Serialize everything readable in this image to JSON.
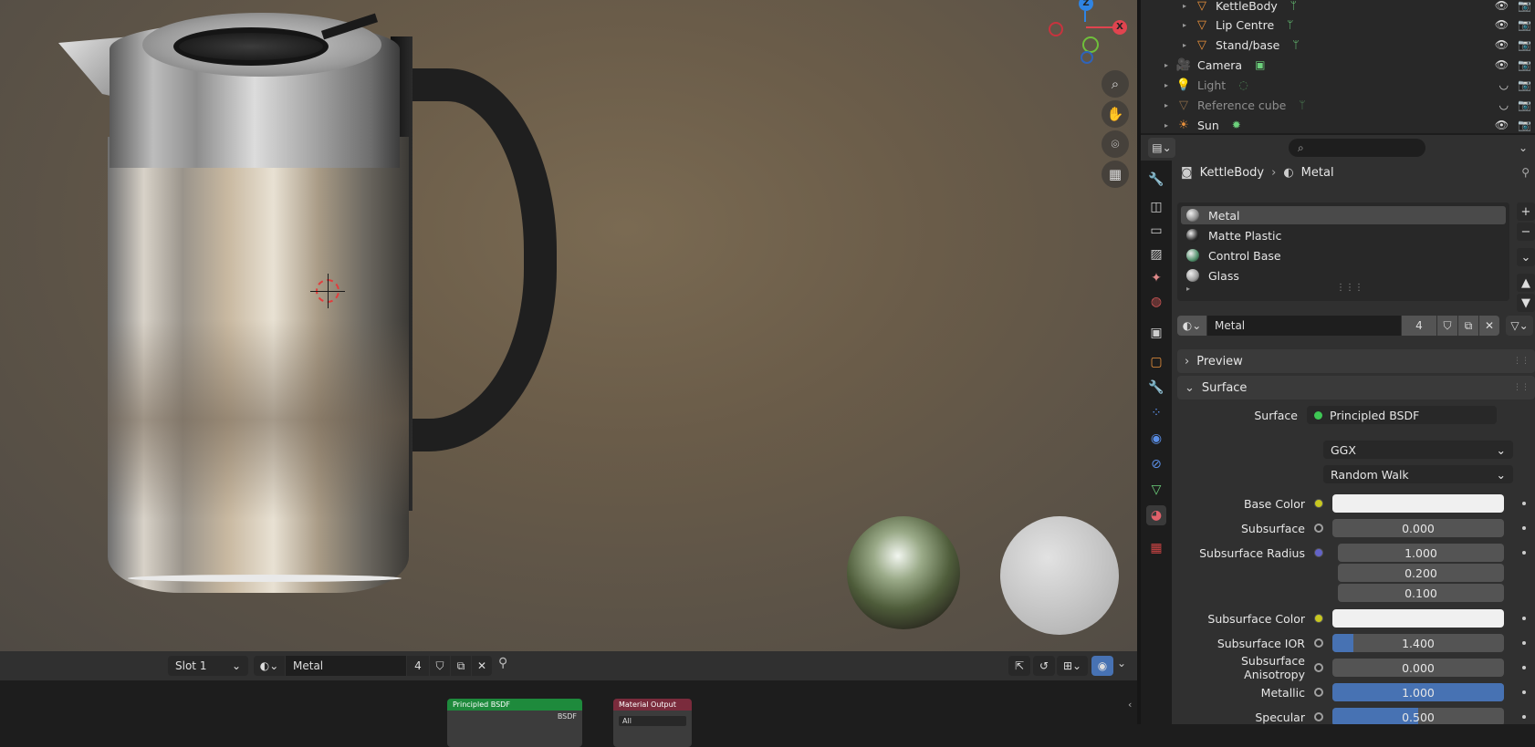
{
  "viewport": {
    "gizmo_labels": {
      "z": "Z",
      "x": "X"
    },
    "nav_icons": [
      "zoom-icon",
      "hand-icon",
      "camera-icon",
      "grid-icon"
    ]
  },
  "viewport_header": {
    "slot": "Slot 1",
    "material_name": "Metal",
    "users": "4"
  },
  "node_editor": {
    "principled_node": {
      "title": "Principled BSDF",
      "output": "BSDF"
    },
    "output_node": {
      "title": "Material Output",
      "target": "All"
    }
  },
  "outliner": {
    "rows": [
      {
        "name": "KettleBody",
        "icon": "mesh-icon",
        "indent": 1,
        "dim": false
      },
      {
        "name": "Lip Centre",
        "icon": "mesh-icon",
        "indent": 1,
        "dim": false
      },
      {
        "name": "Stand/base",
        "icon": "mesh-icon",
        "indent": 1,
        "dim": false
      },
      {
        "name": "Camera",
        "icon": "camera-object-icon",
        "indent": 0,
        "dim": false
      },
      {
        "name": "Light",
        "icon": "light-icon",
        "indent": 0,
        "dim": true
      },
      {
        "name": "Reference cube",
        "icon": "mesh-icon",
        "indent": 0,
        "dim": true
      },
      {
        "name": "Sun",
        "icon": "sun-icon",
        "indent": 0,
        "dim": false
      }
    ]
  },
  "properties": {
    "breadcrumb": {
      "object": "KettleBody",
      "material": "Metal"
    },
    "material_slots": [
      {
        "name": "Metal",
        "color": "#8a8a8a",
        "selected": true
      },
      {
        "name": "Matte Plastic",
        "color": "#2a2a2a",
        "selected": false
      },
      {
        "name": "Control Base",
        "color": "#4f8f6a",
        "selected": false
      },
      {
        "name": "Glass",
        "color": "#9a9a9a",
        "selected": false
      }
    ],
    "material_name": "Metal",
    "material_users": "4",
    "panels": {
      "preview": "Preview",
      "surface": "Surface"
    },
    "surface": {
      "surface_label": "Surface",
      "surface_value": "Principled BSDF",
      "distribution": "GGX",
      "subsurface_method": "Random Walk",
      "rows": [
        {
          "label": "Base Color",
          "socket": "#c8c820",
          "type": "color",
          "value": "",
          "fill": 0
        },
        {
          "label": "Subsurface",
          "socket": "#a0a0a0",
          "type": "number",
          "value": "0.000",
          "fill": 0
        },
        {
          "label": "Subsurface Radius",
          "socket": "#6363c7",
          "type": "vector",
          "values": [
            "1.000",
            "0.200",
            "0.100"
          ]
        },
        {
          "label": "Subsurface Color",
          "socket": "#c8c820",
          "type": "color",
          "value": "",
          "fill": 0
        },
        {
          "label": "Subsurface IOR",
          "socket": "#a0a0a0",
          "type": "number",
          "value": "1.400",
          "fill": 0.12
        },
        {
          "label": "Subsurface Anisotropy",
          "socket": "#a0a0a0",
          "type": "number",
          "value": "0.000",
          "fill": 0
        },
        {
          "label": "Metallic",
          "socket": "#a0a0a0",
          "type": "number",
          "value": "1.000",
          "fill": 1.0
        },
        {
          "label": "Specular",
          "socket": "#a0a0a0",
          "type": "number",
          "value": "0.500",
          "fill": 0.5
        }
      ]
    }
  }
}
